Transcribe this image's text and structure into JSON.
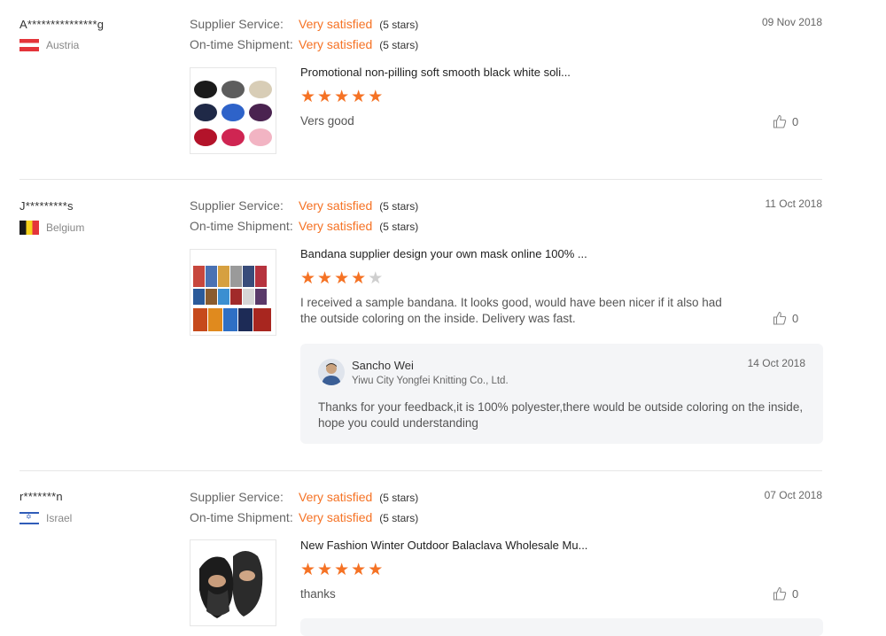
{
  "labels": {
    "supplier_service": "Supplier Service:",
    "ontime_shipment": "On-time Shipment:"
  },
  "colors": {
    "accent": "#f57224",
    "star_off": "#cfcfcf"
  },
  "reviews": [
    {
      "buyer": "A***************g",
      "country": "Austria",
      "flag": "austria-flag",
      "supplier_service": "Very satisfied",
      "supplier_service_stars": "(5 stars)",
      "ontime_shipment": "Very satisfied",
      "ontime_shipment_stars": "(5 stars)",
      "date": "09 Nov 2018",
      "product_title": "Promotional non-pilling soft smooth black white soli...",
      "rating": 5,
      "comment": "Vers good",
      "likes": "0"
    },
    {
      "buyer": "J*********s",
      "country": "Belgium",
      "flag": "belgium-flag",
      "supplier_service": "Very satisfied",
      "supplier_service_stars": "(5 stars)",
      "ontime_shipment": "Very satisfied",
      "ontime_shipment_stars": "(5 stars)",
      "date": "11 Oct 2018",
      "product_title": "Bandana supplier design your own mask online 100% ...",
      "rating": 4,
      "comment": "I received a sample bandana. It looks good, would have been nicer if it also had the outside coloring on the inside. Delivery was fast.",
      "likes": "0",
      "reply": {
        "name": "Sancho Wei",
        "company": "Yiwu City Yongfei Knitting Co., Ltd.",
        "date": "14 Oct 2018",
        "text": "Thanks for your feedback,it is 100% polyester,there would be outside coloring on the inside, hope you could understanding"
      }
    },
    {
      "buyer": "r*******n",
      "country": "Israel",
      "flag": "israel-flag",
      "supplier_service": "Very satisfied",
      "supplier_service_stars": "(5 stars)",
      "ontime_shipment": "Very satisfied",
      "ontime_shipment_stars": "(5 stars)",
      "date": "07 Oct 2018",
      "product_title": "New Fashion Winter Outdoor Balaclava Wholesale Mu...",
      "rating": 5,
      "comment": "thanks",
      "likes": "0"
    }
  ]
}
